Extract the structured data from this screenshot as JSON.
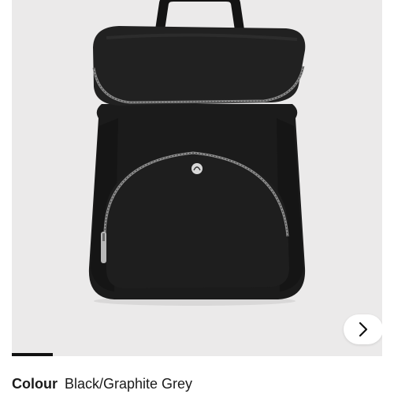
{
  "gallery": {
    "image_subject": "backpack",
    "brand_logo_icon": "lululemon-logo-icon",
    "next_icon": "chevron-right-icon",
    "background_color": "#ebeaea",
    "progress": 0.11
  },
  "colour": {
    "label": "Colour",
    "value": "Black/Graphite Grey"
  }
}
